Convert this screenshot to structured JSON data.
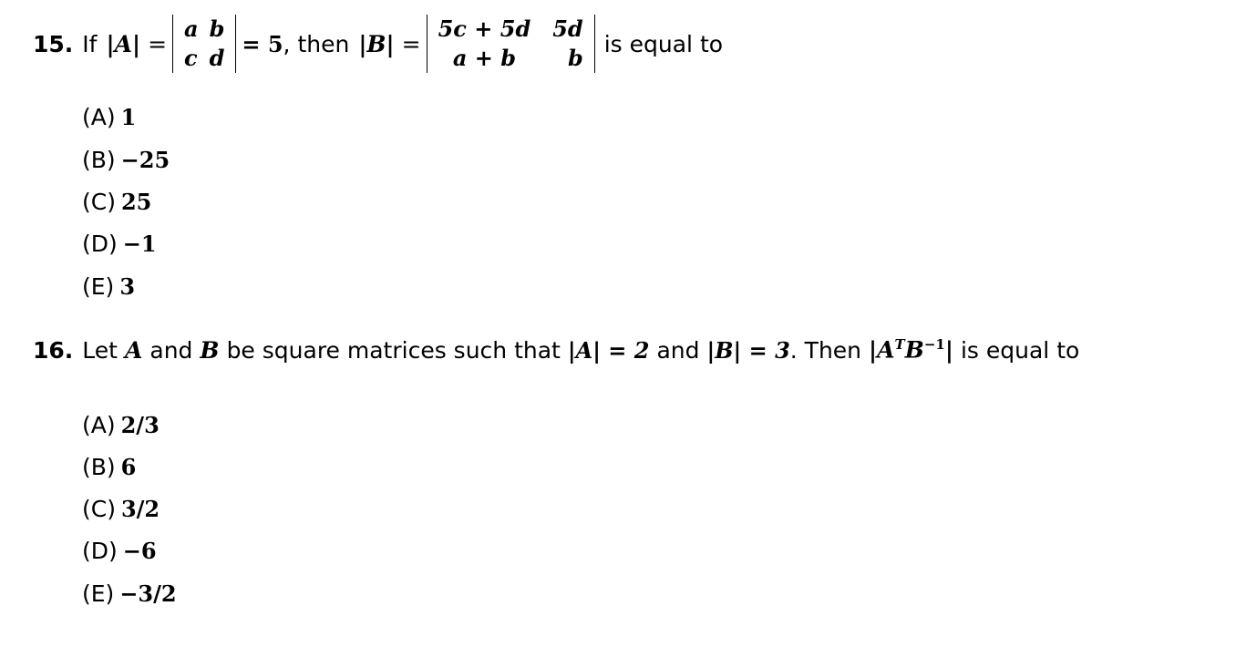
{
  "questions": [
    {
      "number": "15.",
      "text_if": "If",
      "lhs_A": "|A|",
      "eq": "=",
      "det_A": {
        "r1c1": "a",
        "r1c2": "b",
        "r2c1": "c",
        "r2c2": "d"
      },
      "equals_value": "= 5",
      "text_then": ", then",
      "lhs_B": "|B|",
      "det_B": {
        "r1c1": "5c + 5d",
        "r1c2": "5d",
        "r2c1": "a + b",
        "r2c2": "b"
      },
      "tail": "is equal to",
      "options": [
        {
          "label": "(A)",
          "value": "1"
        },
        {
          "label": "(B)",
          "value": "−25"
        },
        {
          "label": "(C)",
          "value": "25"
        },
        {
          "label": "(D)",
          "value": "−1"
        },
        {
          "label": "(E)",
          "value": "3"
        }
      ]
    },
    {
      "number": "16.",
      "t1": "Let",
      "A": "A",
      "t2": "and",
      "B": "B",
      "t3": "be square matrices such that",
      "detA": "|A| = 2",
      "t4": "and",
      "detB": "|B| = 3",
      "t5": ". Then",
      "expr_open": "|A",
      "expr_T": "T",
      "expr_B": "B",
      "expr_inv": "−1",
      "expr_close": "|",
      "tail": "is equal to",
      "options": [
        {
          "label": "(A)",
          "value": "2/3"
        },
        {
          "label": "(B)",
          "value": "6"
        },
        {
          "label": "(C)",
          "value": "3/2"
        },
        {
          "label": "(D)",
          "value": "−6"
        },
        {
          "label": "(E)",
          "value": "−3/2"
        }
      ]
    }
  ]
}
